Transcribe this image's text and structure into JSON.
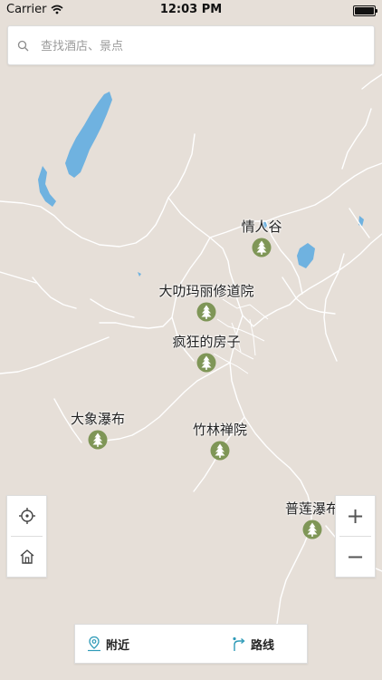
{
  "status_bar": {
    "carrier": "Carrier",
    "time": "12:03 PM"
  },
  "search": {
    "placeholder": "查找酒店、景点"
  },
  "map": {
    "colors": {
      "land": "#e6dfd8",
      "water": "#6fb2e0",
      "road": "#ffffff",
      "marker": "#7f9657"
    },
    "pois": [
      {
        "name": "情人谷"
      },
      {
        "name": "大叻玛丽修道院"
      },
      {
        "name": "疯狂的房子"
      },
      {
        "name": "大象瀑布"
      },
      {
        "name": "竹林禅院"
      },
      {
        "name": "普莲瀑布"
      }
    ]
  },
  "controls": {
    "zoom_in": "+",
    "zoom_out": "−"
  },
  "bottom_bar": {
    "nearby_label": "附近",
    "route_label": "路线"
  }
}
